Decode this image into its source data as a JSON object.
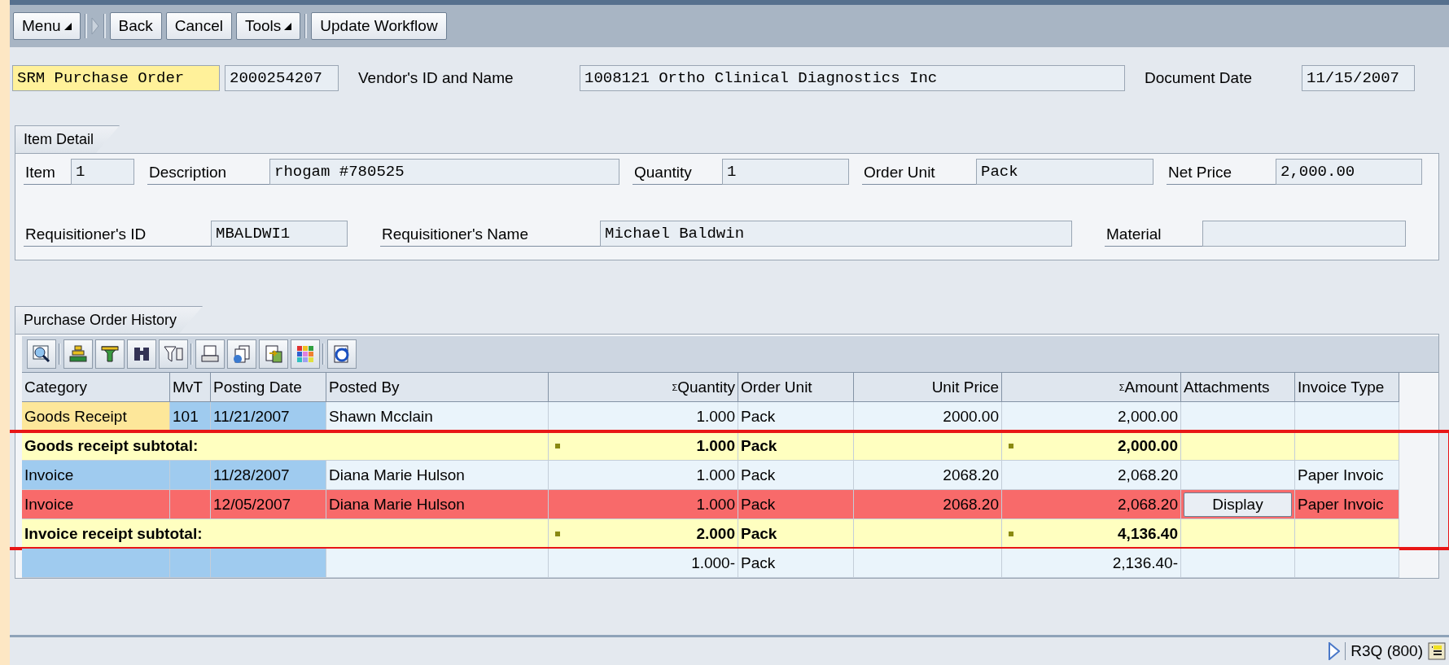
{
  "toolbar": [
    {
      "kind": "button",
      "label": "Menu",
      "has_menu": true
    },
    {
      "kind": "divider"
    },
    {
      "kind": "arrow"
    },
    {
      "kind": "divider"
    },
    {
      "kind": "button",
      "label": "Back",
      "has_menu": false
    },
    {
      "kind": "button",
      "label": "Cancel",
      "has_menu": false
    },
    {
      "kind": "button",
      "label": "Tools",
      "has_menu": true
    },
    {
      "kind": "divider"
    },
    {
      "kind": "button",
      "label": "Update Workflow",
      "has_menu": false
    }
  ],
  "header": {
    "doc_type": "SRM Purchase Order",
    "doc_number": "2000254207",
    "fields": [
      {
        "label": "Vendor's ID and Name",
        "value": "1008121 Ortho Clinical Diagnostics Inc"
      },
      {
        "label": "Document Date",
        "value": "11/15/2007"
      }
    ]
  },
  "item_detail": {
    "title": "Item Detail",
    "lines": [
      {
        "fields": [
          {
            "label": "Item",
            "value": "1"
          },
          {
            "label": "Description",
            "value": "rhogam #780525"
          },
          {
            "label": "Quantity",
            "value": "1"
          },
          {
            "label": "Order Unit",
            "value": "Pack"
          },
          {
            "label": "Net Price",
            "value": "2,000.00"
          }
        ]
      },
      {
        "fields": [
          {
            "label": "Requisitioner's ID",
            "value": "MBALDWI1"
          },
          {
            "label": "Requisitioner's Name",
            "value": "Michael Baldwin"
          },
          {
            "label": "Material"
          }
        ]
      }
    ]
  },
  "history": {
    "title": "Purchase Order History",
    "columns": [
      {
        "label": "Category"
      },
      {
        "label": "MvT"
      },
      {
        "label": "Posting Date"
      },
      {
        "label": "Posted By"
      },
      {
        "label": "Quantity",
        "sum_mark": "Σ"
      },
      {
        "label": "Order Unit"
      },
      {
        "label": "Unit Price"
      },
      {
        "label": "Amount",
        "sum_mark": "Σ"
      },
      {
        "label": "Attachments"
      },
      {
        "label": "Invoice Type"
      }
    ],
    "rows": [
      {
        "kind": "item",
        "highlighted": false,
        "alert": false,
        "color": "#fde79a",
        "cells": [
          "Goods Receipt",
          "101",
          "11/21/2007",
          "Shawn Mcclain",
          "1.000",
          "Pack",
          "2000.00",
          "2,000.00",
          null,
          null
        ]
      },
      {
        "kind": "subtotal",
        "highlighted": true,
        "label": "Goods receipt subtotal:",
        "quantity": "1.000",
        "unit": "Pack",
        "amount": "2,000.00"
      },
      {
        "kind": "item",
        "highlighted": true,
        "alert": false,
        "color": "#9fcbef",
        "cells": [
          "Invoice",
          null,
          "11/28/2007",
          "Diana Marie Hulson",
          "1.000",
          "Pack",
          "2068.20",
          "2,068.20",
          null,
          "Paper Invoic"
        ]
      },
      {
        "kind": "item",
        "highlighted": true,
        "alert": true,
        "cells": [
          "Invoice",
          null,
          "12/05/2007",
          "Diana Marie Hulson",
          "1.000",
          "Pack",
          "2068.20",
          "2,068.20",
          "Display",
          "Paper Invoic"
        ]
      },
      {
        "kind": "subtotal",
        "highlighted": true,
        "label": "Invoice receipt subtotal:",
        "quantity": "2.000",
        "unit": "Pack",
        "amount": "4,136.40"
      },
      {
        "kind": "item",
        "highlighted": false,
        "alert": false,
        "color": "#9fcbef",
        "cells": [
          null,
          null,
          null,
          null,
          "1.000-",
          "Pack",
          null,
          "2,136.40-",
          null,
          null
        ]
      }
    ]
  },
  "status_bar": {
    "system": "R3Q (800)"
  }
}
